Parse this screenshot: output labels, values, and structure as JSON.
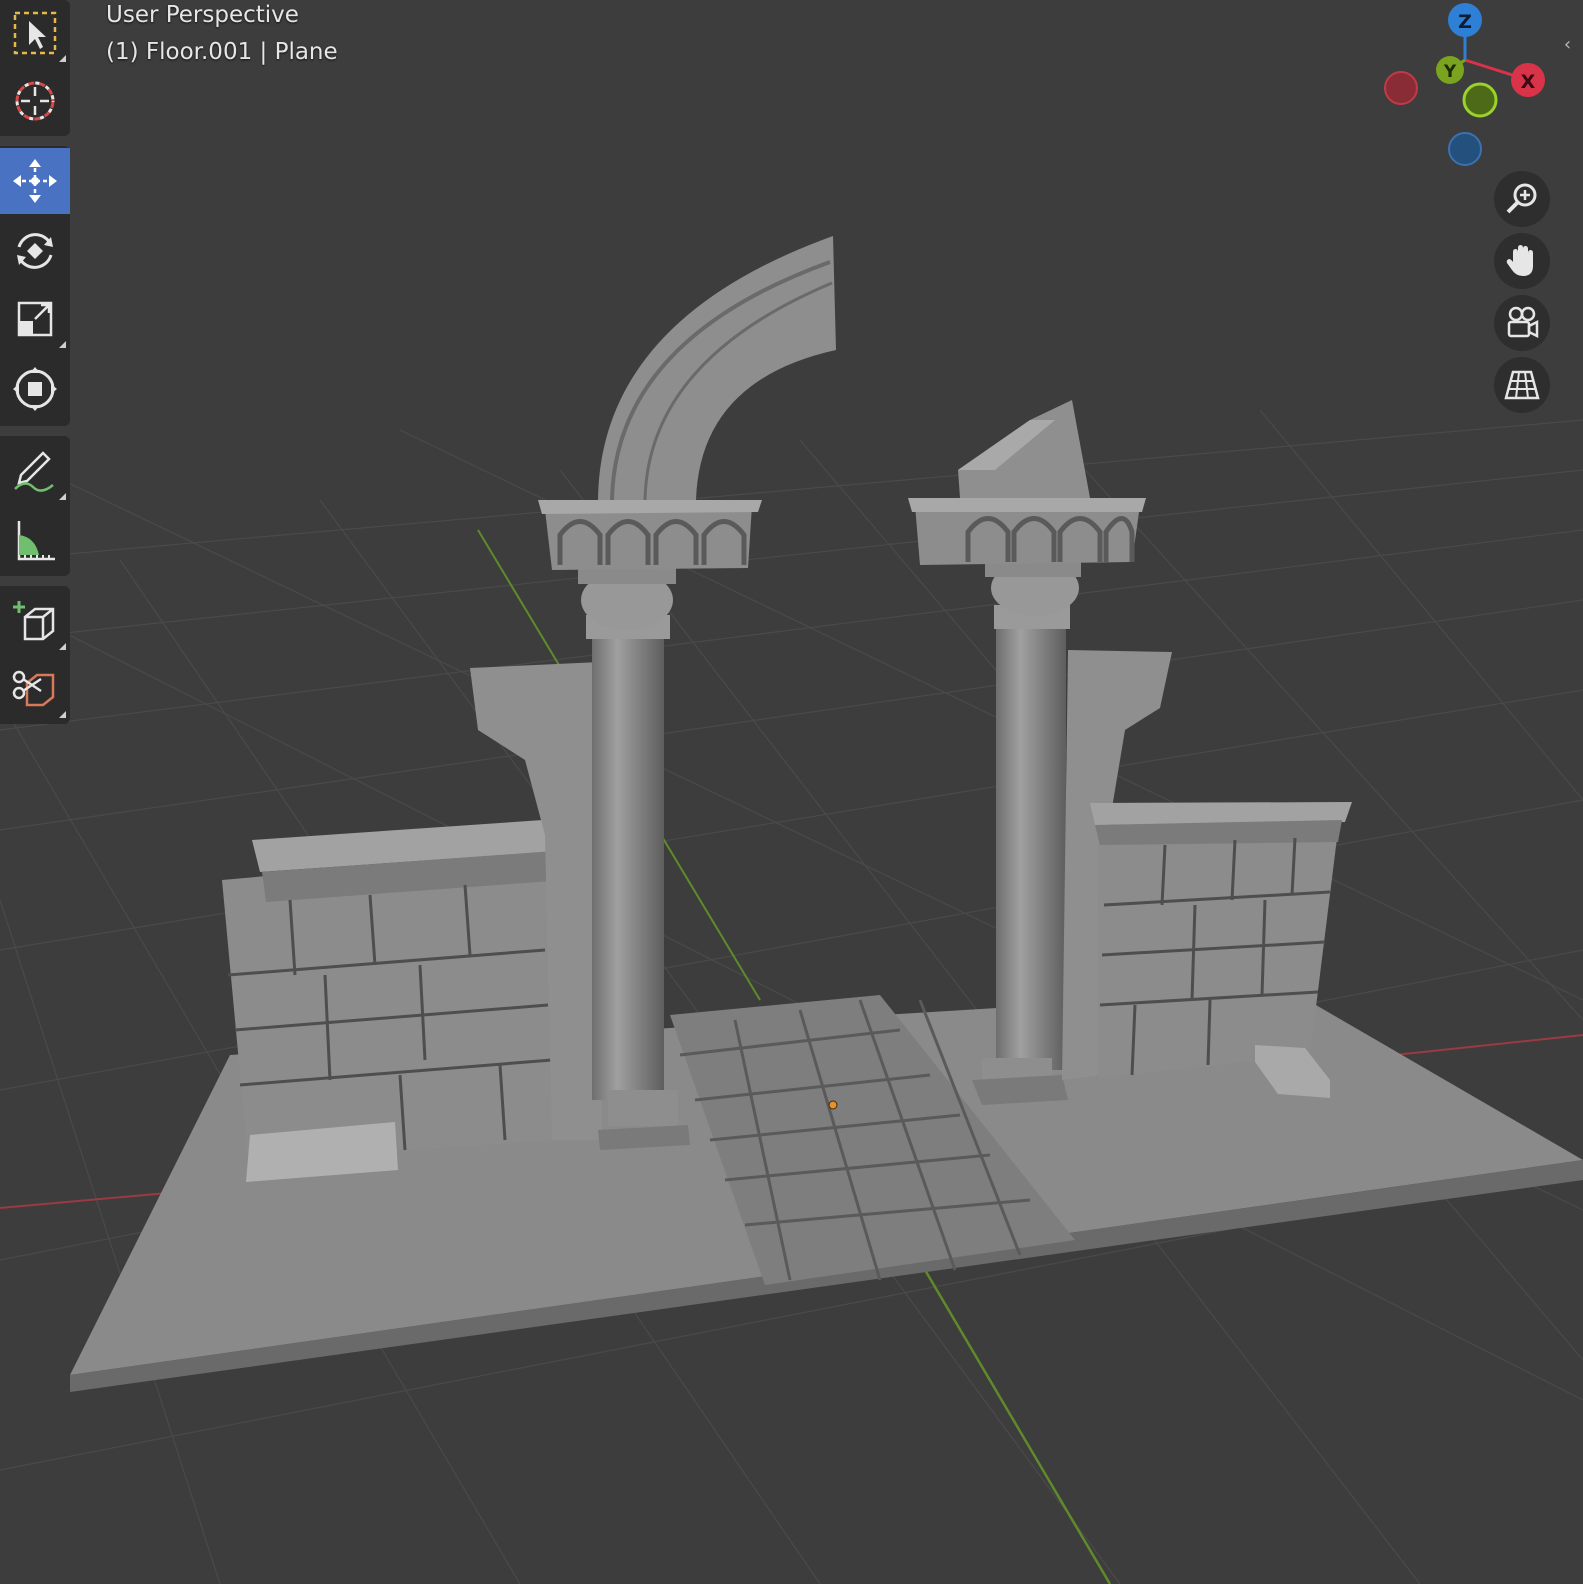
{
  "viewport": {
    "view_name": "User Perspective",
    "object_info": "(1) Floor.001 | Plane"
  },
  "gizmo": {
    "axis_z": "Z",
    "axis_y": "Y",
    "axis_x": "X",
    "colors": {
      "x": "#d9334a",
      "y": "#7aa31f",
      "z": "#2e7fd6"
    }
  },
  "toolbar": {
    "tools": [
      "select-box",
      "cursor",
      "move",
      "rotate",
      "scale",
      "transform",
      "annotate",
      "measure",
      "add-cube",
      "cut"
    ],
    "active_tool": "move",
    "accent": "#4a72c2"
  },
  "navigation": {
    "buttons": [
      "zoom",
      "pan",
      "camera-view",
      "perspective-toggle"
    ]
  }
}
